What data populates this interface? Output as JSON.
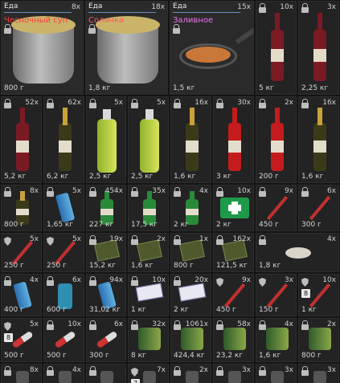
{
  "row1": [
    {
      "category": "Еда",
      "name": "Чесночный суп",
      "name_color": "#ff3b3b",
      "count": "8x",
      "weight": "800 г",
      "icon": "soup-pot-icon"
    },
    {
      "category": "Еда",
      "name": "Солянка",
      "name_color": "#ff5a5a",
      "count": "18x",
      "weight": "1,8 кг",
      "icon": "soup-pot-icon"
    },
    {
      "category": "Еда",
      "name": "Заливное",
      "name_color": "#e878e8",
      "count": "15x",
      "weight": "1,5 кг",
      "icon": "frying-pan-icon"
    },
    {
      "count": "10x",
      "weight": "5 кг",
      "icon": "wine-bottle-icon"
    },
    {
      "count": "3x",
      "weight": "2,25 кг",
      "icon": "wine-bottle-icon"
    }
  ],
  "row2": [
    {
      "count": "52x",
      "weight": "5,2 кг",
      "icon": "wine-bottle-icon"
    },
    {
      "count": "62x",
      "weight": "6,2 кг",
      "icon": "champagne-bottle-icon"
    },
    {
      "count": "5x",
      "weight": "2,5 кг",
      "icon": "plastic-bottle-icon"
    },
    {
      "count": "5x",
      "weight": "2,5 кг",
      "icon": "plastic-bottle-icon"
    },
    {
      "count": "16x",
      "weight": "1,6 кг",
      "icon": "champagne-bottle-icon"
    },
    {
      "count": "30x",
      "weight": "3 кг",
      "icon": "ketchup-bottle-icon"
    },
    {
      "count": "2x",
      "weight": "200 г",
      "icon": "ketchup-bottle-icon"
    },
    {
      "count": "16x",
      "weight": "1,6 кг",
      "icon": "champagne-bottle-icon"
    }
  ],
  "row3": [
    {
      "count": "8x",
      "weight": "800 г",
      "icon": "champagne-bottle-icon"
    },
    {
      "count": "5x",
      "weight": "1,65 кг",
      "icon": "energy-can-icon"
    },
    {
      "count": "454x",
      "weight": "227 кг",
      "icon": "green-bottle-icon"
    },
    {
      "count": "35x",
      "weight": "17,5 кг",
      "icon": "green-bottle-icon"
    },
    {
      "count": "4x",
      "weight": "2 кг",
      "icon": "green-bottle-icon"
    },
    {
      "count": "10x",
      "weight": "2 кг",
      "icon": "medkit-icon"
    },
    {
      "count": "9x",
      "weight": "450 г",
      "icon": "injector-icon"
    },
    {
      "count": "6x",
      "weight": "300 г",
      "icon": "injector-icon"
    }
  ],
  "row4": [
    {
      "count": "5x",
      "weight": "250 г",
      "icon": "injector-icon"
    },
    {
      "count": "5x",
      "weight": "250 г",
      "icon": "injector-icon"
    },
    {
      "count": "19x",
      "weight": "15,2 кг",
      "icon": "ration-pack-icon"
    },
    {
      "count": "2x",
      "weight": "1,6 кг",
      "icon": "ration-pack-icon"
    },
    {
      "count": "1x",
      "weight": "800 г",
      "icon": "ration-pack-icon"
    },
    {
      "count": "162x",
      "weight": "121,5 кг",
      "icon": "ration-pack-icon"
    },
    {
      "count": "4x",
      "weight": "1,8 кг",
      "icon": "food-plate-icon"
    }
  ],
  "row5": [
    {
      "count": "4x",
      "weight": "400 г",
      "icon": "energy-can-icon"
    },
    {
      "count": "6x",
      "weight": "600 г",
      "icon": "spray-bottle-icon"
    },
    {
      "count": "94x",
      "weight": "31,02 кг",
      "icon": "energy-can-icon"
    },
    {
      "count": "10x",
      "weight": "1 кг",
      "icon": "pill-pack-icon"
    },
    {
      "count": "20x",
      "weight": "2 кг",
      "icon": "pill-pack-icon"
    },
    {
      "count": "9x",
      "weight": "450 г",
      "icon": "injector-icon"
    },
    {
      "count": "3x",
      "weight": "150 г",
      "icon": "injector-icon"
    },
    {
      "count": "10x",
      "weight": "1 кг",
      "icon": "syringe-icon",
      "badge": "8"
    }
  ],
  "row6": [
    {
      "count": "5x",
      "weight": "500 г",
      "icon": "pills-icon",
      "badge": "8"
    },
    {
      "count": "10x",
      "weight": "500 г",
      "icon": "pills-icon"
    },
    {
      "count": "6x",
      "weight": "300 г",
      "icon": "pills-icon"
    },
    {
      "count": "32x",
      "weight": "8 кг",
      "icon": "tin-can-icon"
    },
    {
      "count": "1061x",
      "weight": "424,4 кг",
      "icon": "tin-can-icon"
    },
    {
      "count": "58x",
      "weight": "23,2 кг",
      "icon": "tin-can-icon"
    },
    {
      "count": "4x",
      "weight": "1,6 кг",
      "icon": "tin-can-icon"
    },
    {
      "count": "2x",
      "weight": "800 г",
      "icon": "tin-can-icon"
    }
  ],
  "row7": [
    {
      "count": "8x",
      "icon": "item-icon"
    },
    {
      "count": "4x",
      "icon": "item-icon"
    },
    {
      "count": "",
      "icon": "item-icon"
    },
    {
      "count": "7x",
      "icon": "item-icon",
      "badge": "7"
    },
    {
      "count": "2x",
      "icon": "item-icon"
    },
    {
      "count": "3x",
      "icon": "item-icon"
    },
    {
      "count": "3x",
      "icon": "item-icon"
    },
    {
      "count": "3x",
      "icon": "item-icon"
    }
  ]
}
